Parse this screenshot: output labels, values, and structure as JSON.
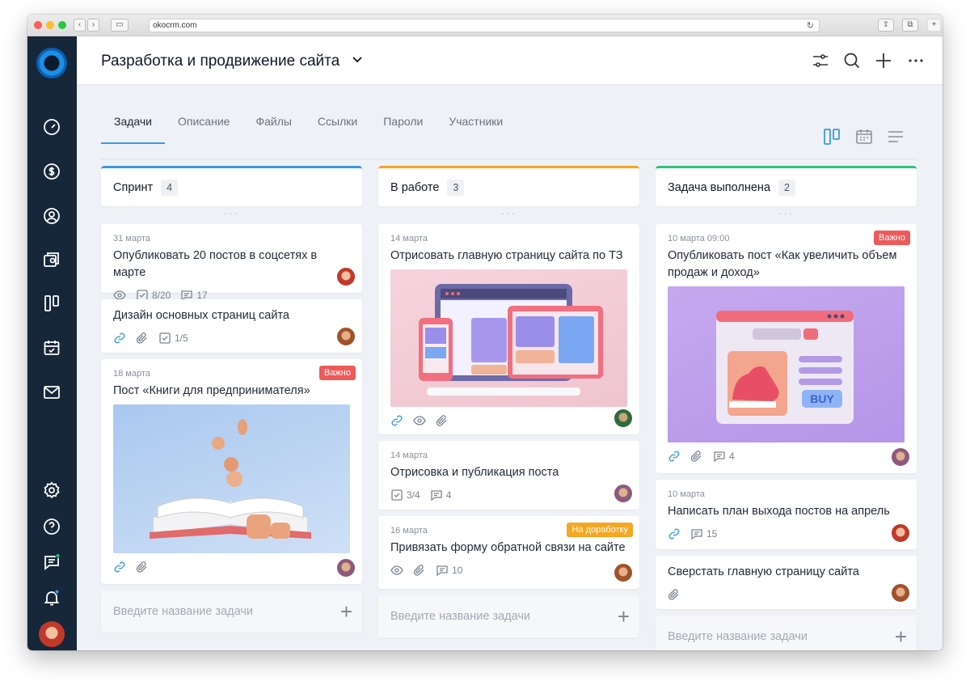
{
  "browser": {
    "url": "okocrm.com"
  },
  "project": {
    "title": "Разработка и продвижение сайта"
  },
  "tabs": [
    {
      "label": "Задачи",
      "active": true
    },
    {
      "label": "Описание"
    },
    {
      "label": "Файлы"
    },
    {
      "label": "Ссылки"
    },
    {
      "label": "Пароли"
    },
    {
      "label": "Участники"
    }
  ],
  "colors": {
    "sidebar": "#16273a",
    "accent_blue": "#3b9be0",
    "accent_orange": "#f5a623",
    "accent_green": "#2ec27e",
    "tag_red": "#ee5a5a",
    "tag_orange": "#f5a623"
  },
  "columns": [
    {
      "name": "Спринт",
      "count": "4",
      "cards": [
        {
          "date": "31 марта",
          "title": "Опубликовать 20 постов в соцсетях в марте",
          "meta": [
            {
              "icon": "eye-icon"
            },
            {
              "icon": "checklist-icon",
              "text": "8/20"
            },
            {
              "icon": "comment-icon",
              "text": "17"
            }
          ]
        },
        {
          "title": "Дизайн основных страниц сайта",
          "meta": [
            {
              "icon": "link-icon"
            },
            {
              "icon": "attachment-icon"
            },
            {
              "icon": "checklist-icon",
              "text": "1/5"
            }
          ]
        },
        {
          "date": "18 марта",
          "tag": "Важно",
          "title": "Пост «Книги для предпринимателя»",
          "meta": [
            {
              "icon": "link-icon"
            },
            {
              "icon": "attachment-icon"
            }
          ]
        }
      ],
      "add_placeholder": "Введите название задачи"
    },
    {
      "name": "В работе",
      "count": "3",
      "cards": [
        {
          "date": "14 марта",
          "title": "Отрисовать главную страницу сайта по ТЗ",
          "meta": [
            {
              "icon": "link-icon"
            },
            {
              "icon": "eye-icon"
            },
            {
              "icon": "attachment-icon"
            }
          ]
        },
        {
          "date": "14 марта",
          "title": "Отрисовка и публикация поста",
          "meta": [
            {
              "icon": "checklist-icon",
              "text": "3/4"
            },
            {
              "icon": "comment-icon",
              "text": "4"
            }
          ]
        },
        {
          "date": "16 марта",
          "tag": "На доработку",
          "title": "Привязать форму обратной связи на сайте",
          "meta": [
            {
              "icon": "eye-icon"
            },
            {
              "icon": "attachment-icon"
            },
            {
              "icon": "comment-icon",
              "text": "10"
            }
          ]
        }
      ],
      "add_placeholder": "Введите название задачи"
    },
    {
      "name": "Задача выполнена",
      "count": "2",
      "cards": [
        {
          "date": "10 марта 09:00",
          "tag": "Важно",
          "title": "Опубликовать пост «Как увеличить объем продаж и доход»",
          "image_text": "BUY",
          "meta": [
            {
              "icon": "link-icon"
            },
            {
              "icon": "attachment-icon"
            },
            {
              "icon": "comment-icon",
              "text": "4"
            }
          ]
        },
        {
          "date": "10 марта",
          "title": "Написать план выхода постов на апрель",
          "meta": [
            {
              "icon": "link-icon"
            },
            {
              "icon": "comment-icon",
              "text": "15"
            }
          ]
        },
        {
          "title": "Сверстать главную страницу сайта",
          "meta": [
            {
              "icon": "attachment-icon"
            }
          ]
        }
      ],
      "add_placeholder": "Введите название задачи"
    }
  ]
}
